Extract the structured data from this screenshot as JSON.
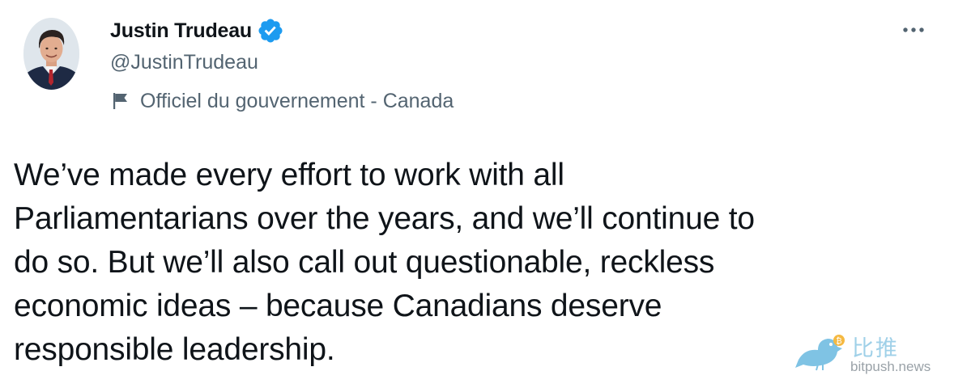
{
  "tweet": {
    "author": {
      "display_name": "Justin Trudeau",
      "handle": "@JustinTrudeau",
      "verified": true,
      "label": "Officiel du gouvernement - Canada"
    },
    "text": "We’ve made every effort to work with all\nParliamentarians over the years, and we’ll continue to\ndo so. But we’ll also call out questionable, reckless\neconomic ideas – because Canadians deserve\nresponsible leadership."
  },
  "watermark": {
    "cn": "比推",
    "en": "bitpush.news"
  },
  "colors": {
    "text_primary": "#0f1419",
    "text_secondary": "#536471",
    "verified_blue": "#1d9bf0",
    "watermark_blue": "#9fd0e8"
  },
  "icons": {
    "verified": "verified-badge-icon",
    "label": "flag-icon",
    "more": "more-horizontal-icon",
    "watermark": "bird-logo-icon"
  }
}
